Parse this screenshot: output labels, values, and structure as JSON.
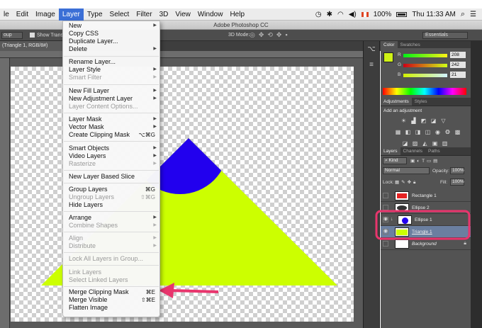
{
  "menubar": {
    "items": [
      "le",
      "Edit",
      "Image",
      "Layer",
      "Type",
      "Select",
      "Filter",
      "3D",
      "View",
      "Window",
      "Help"
    ],
    "battery": "100%",
    "clock": "Thu 11:33 AM"
  },
  "app_title": "Adobe Photoshop CC",
  "options_bar": {
    "left_dropdown": "oup",
    "show_transform": "Show Transfo",
    "mode_3d": "3D Mode:",
    "workspace": "Essentials"
  },
  "document_tab": "(Triangle 1, RGB/8#)",
  "layer_menu": {
    "items": [
      {
        "label": "New",
        "arrow": true
      },
      {
        "label": "Copy CSS"
      },
      {
        "label": "Duplicate Layer..."
      },
      {
        "label": "Delete",
        "arrow": true
      },
      {
        "label": "Rename Layer..."
      },
      {
        "label": "Layer Style",
        "arrow": true
      },
      {
        "label": "Smart Filter",
        "arrow": true,
        "disabled": true
      },
      {
        "label": "New Fill Layer",
        "arrow": true
      },
      {
        "label": "New Adjustment Layer",
        "arrow": true
      },
      {
        "label": "Layer Content Options...",
        "disabled": true
      },
      {
        "label": "Layer Mask",
        "arrow": true
      },
      {
        "label": "Vector Mask",
        "arrow": true
      },
      {
        "label": "Create Clipping Mask",
        "shortcut": "⌥⌘G"
      },
      {
        "label": "Smart Objects",
        "arrow": true
      },
      {
        "label": "Video Layers",
        "arrow": true
      },
      {
        "label": "Rasterize",
        "arrow": true,
        "disabled": true
      },
      {
        "label": "New Layer Based Slice"
      },
      {
        "label": "Group Layers",
        "shortcut": "⌘G"
      },
      {
        "label": "Ungroup Layers",
        "shortcut": "⇧⌘G",
        "disabled": true
      },
      {
        "label": "Hide Layers"
      },
      {
        "label": "Arrange",
        "arrow": true
      },
      {
        "label": "Combine Shapes",
        "arrow": true,
        "disabled": true
      },
      {
        "label": "Align",
        "arrow": true,
        "disabled": true
      },
      {
        "label": "Distribute",
        "arrow": true,
        "disabled": true
      },
      {
        "label": "Lock All Layers in Group...",
        "disabled": true
      },
      {
        "label": "Link Layers",
        "disabled": true
      },
      {
        "label": "Select Linked Layers",
        "disabled": true
      },
      {
        "label": "Merge Clipping Mask",
        "shortcut": "⌘E"
      },
      {
        "label": "Merge Visible",
        "shortcut": "⇧⌘E"
      },
      {
        "label": "Flatten Image"
      }
    ]
  },
  "color_panel": {
    "tabs": [
      "Color",
      "Swatches"
    ],
    "channels": [
      {
        "label": "R",
        "value": "208"
      },
      {
        "label": "G",
        "value": "242"
      },
      {
        "label": "B",
        "value": "21"
      }
    ],
    "foreground": "#d0f215"
  },
  "adjustments_panel": {
    "tabs": [
      "Adjustments",
      "Styles"
    ],
    "add_label": "Add an adjustment"
  },
  "layers_panel": {
    "tabs": [
      "Layers",
      "Channels",
      "Paths"
    ],
    "kind": "Kind",
    "blend_mode": "Normal",
    "opacity_label": "Opacity:",
    "opacity": "100%",
    "lock_label": "Lock:",
    "fill_label": "Fill:",
    "fill": "100%",
    "layers": [
      {
        "name": "Rectangle 1",
        "visible": false
      },
      {
        "name": "Ellipse 2",
        "visible": false
      },
      {
        "name": "Ellipse 1",
        "visible": true
      },
      {
        "name": "Triangle 1",
        "visible": true,
        "selected": true
      },
      {
        "name": "Background",
        "visible": false,
        "locked": true
      }
    ]
  },
  "colors": {
    "triangle": "#ccff00",
    "ellipse": "#2200ee",
    "highlight": "#e8356d",
    "menu_active": "#3b6fd6"
  }
}
